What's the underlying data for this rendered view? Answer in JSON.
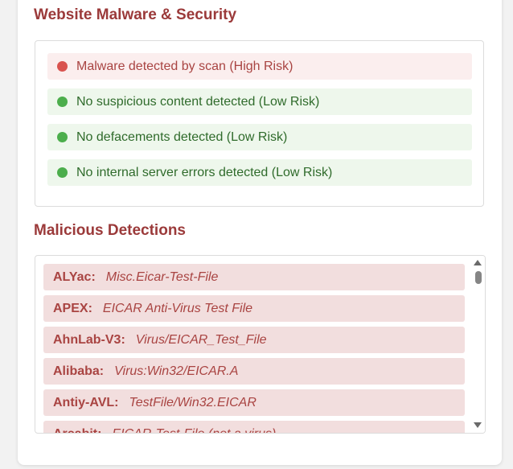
{
  "security": {
    "title": "Website Malware & Security",
    "items": [
      {
        "label": "Malware detected by scan (High Risk)",
        "risk": "high"
      },
      {
        "label": "No suspicious content detected (Low Risk)",
        "risk": "low"
      },
      {
        "label": "No defacements detected (Low Risk)",
        "risk": "low"
      },
      {
        "label": "No internal server errors detected (Low Risk)",
        "risk": "low"
      }
    ]
  },
  "detections": {
    "title": "Malicious Detections",
    "items": [
      {
        "engine": "ALYac:",
        "result": "Misc.Eicar-Test-File"
      },
      {
        "engine": "APEX:",
        "result": "EICAR Anti-Virus Test File"
      },
      {
        "engine": "AhnLab-V3:",
        "result": "Virus/EICAR_Test_File"
      },
      {
        "engine": "Alibaba:",
        "result": "Virus:Win32/EICAR.A"
      },
      {
        "engine": "Antiy-AVL:",
        "result": "TestFile/Win32.EICAR"
      },
      {
        "engine": "Arcabit:",
        "result": "EICAR-Test-File (not a virus)"
      }
    ]
  },
  "colors": {
    "title": "#9b3a3a",
    "high_dot": "#d9534f",
    "low_dot": "#4cae4c",
    "detection_bg": "#f2dede"
  },
  "icons": {
    "high": "red-status-dot-icon",
    "low": "green-status-dot-icon",
    "scroll_up": "scroll-up-arrow-icon",
    "scroll_down": "scroll-down-arrow-icon"
  }
}
